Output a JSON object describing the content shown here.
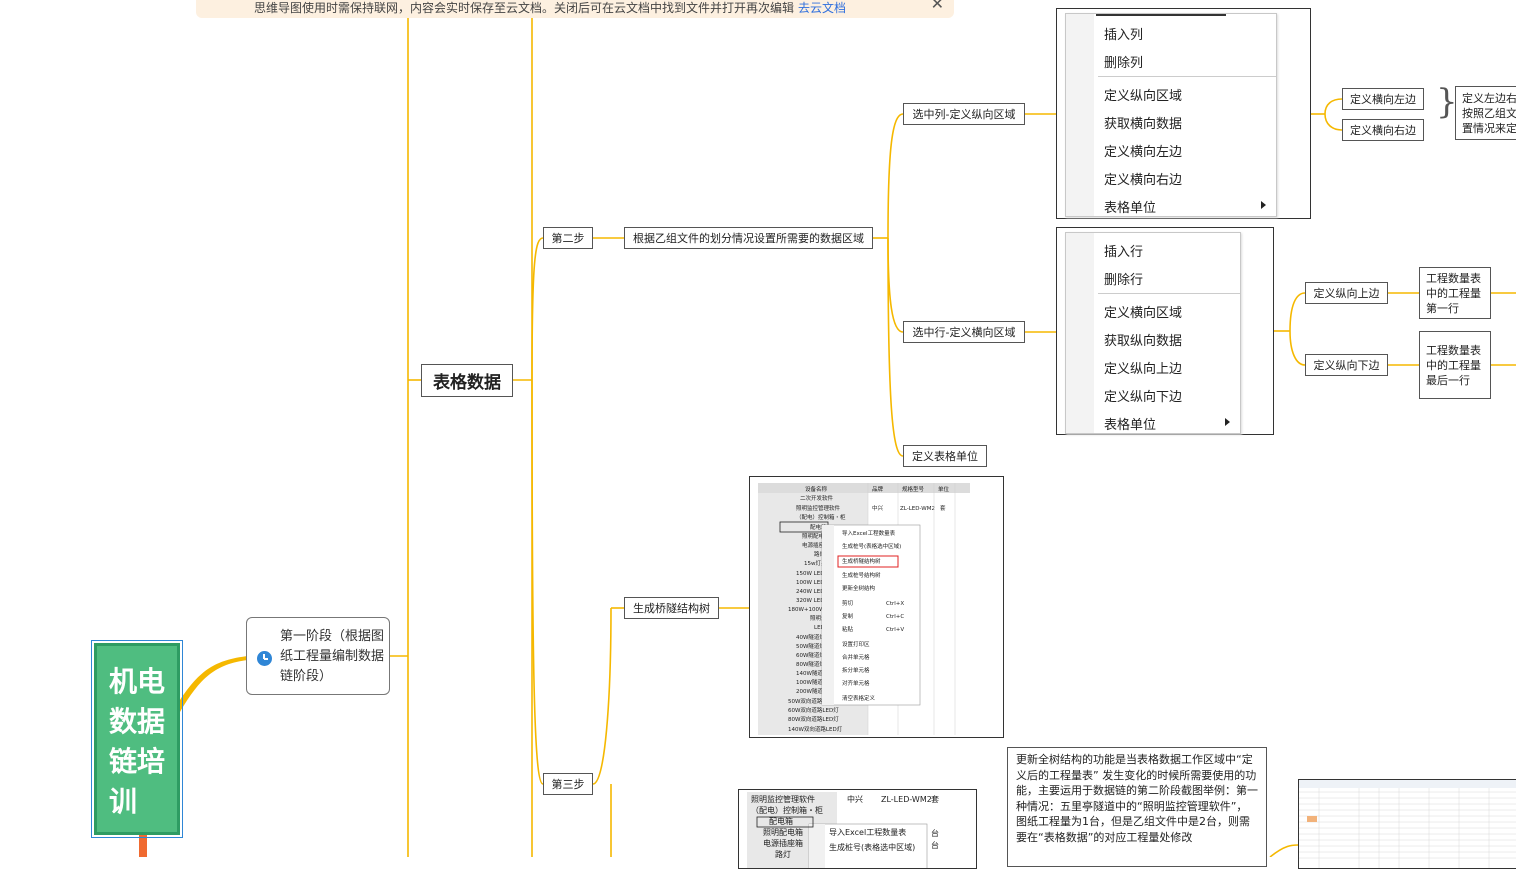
{
  "banner": {
    "message": "思维导图使用时需保持联网，内容会实时保存至云文档。关闭后可在云文档中找到文件并打开再次编辑",
    "link_label": "去云文档",
    "close_icon": "close-icon"
  },
  "central_topic": {
    "lines": [
      "机电",
      "数据",
      "链培",
      "训"
    ]
  },
  "stage1": {
    "icon": "clock-icon",
    "label": "第一阶段（根据图纸工程量编制数据链阶段）"
  },
  "main_topic": {
    "label": "表格数据"
  },
  "steps": {
    "step2": "第二步",
    "step3": "第三步"
  },
  "step2": {
    "desc": "根据乙组文件的划分情况设置所需要的数据区域",
    "col_select": "选中列-定义纵向区域",
    "row_select": "选中行-定义横向区域",
    "unit_define": "定义表格单位"
  },
  "col_menu": {
    "items": [
      "插入列",
      "删除列",
      "定义纵向区域",
      "获取横向数据",
      "定义横向左边",
      "定义横向右边",
      "表格单位"
    ]
  },
  "row_menu": {
    "items": [
      "插入行",
      "删除行",
      "定义横向区域",
      "获取纵向数据",
      "定义纵向上边",
      "定义纵向下边",
      "表格单位"
    ]
  },
  "horiz": {
    "left": "定义横向左边",
    "right": "定义横向右边",
    "note": "定义左边右按照乙组文置情况来定"
  },
  "vert": {
    "top": "定义纵向上边",
    "bottom": "定义纵向下边",
    "top_note": "工程数量表中的工程量第一行",
    "bottom_note": "工程数量表中的工程量最后一行"
  },
  "step3": {
    "bridge": "生成桥隧结构树",
    "note": "更新全树结构的功能是当表格数据工作区域中“定义后的工程量表” 发生变化的时候所需要使用的功能，主要运用于数据链的第二阶段截图举例：第一种情况：五里亭隧道中的“照明监控管理软件”，图纸工程量为1台，但是乙组文件中是2台，则需要在“表格数据”的对应工程量处修改"
  },
  "screenshot1": {
    "headers": [
      "设备名称",
      "品牌",
      "规格型号",
      "单位"
    ],
    "rows": [
      "二次开发软件",
      "照明监控管理软件",
      "（配电）控制箱・柜",
      "配电箱",
      "照明配电箱",
      "电源插座箱",
      "路灯",
      "15w灯具",
      "150W LED灯",
      "100W LED灯",
      "240W LED灯",
      "320W LED灯",
      "180W+100W LED",
      "照明灯",
      "LED",
      "40W隧道灯",
      "50W隧道灯",
      "60W隧道灯",
      "80W隧道灯",
      "140W隧道灯",
      "100W隧道灯",
      "200W隧道灯",
      "50W双向道路LED灯",
      "60W双向道路LED灯",
      "80W双向道路LED灯",
      "140W双向道路LED灯"
    ],
    "brand_cell": "中兴",
    "model_cell": "ZL-LED-WM2",
    "unit_cell": "套",
    "ctx_menu": [
      "导入Excel工程数量表",
      "生成桩号(表格选中区域)",
      "生成桥隧结构树",
      "生成桩号结构树",
      "更新全树结构",
      "剪切",
      "复制",
      "粘贴",
      "设置打印区",
      "合并单元格",
      "拆分单元格",
      "对齐单元格",
      "清空表格定义"
    ],
    "shortcuts": [
      "Ctrl+X",
      "Ctrl+C",
      "Ctrl+V"
    ]
  },
  "screenshot2": {
    "rows": [
      "照明监控管理软件",
      "（配电）控制箱・柜",
      "配电箱",
      "照明配电箱",
      "电源插座箱",
      "路灯"
    ],
    "brand_cell": "中兴",
    "model_cell": "ZL-LED-WM2",
    "unit_cell": "套",
    "ctx_menu": [
      "导入Excel工程数量表",
      "生成桩号(表格选中区域)"
    ],
    "unit_col": [
      "台",
      "台"
    ]
  },
  "colors": {
    "branch": "#f5b800",
    "central": "#4fbd80",
    "central_border": "#2e9c63",
    "link": "#2f6fdd",
    "highlight": "#e02020"
  }
}
